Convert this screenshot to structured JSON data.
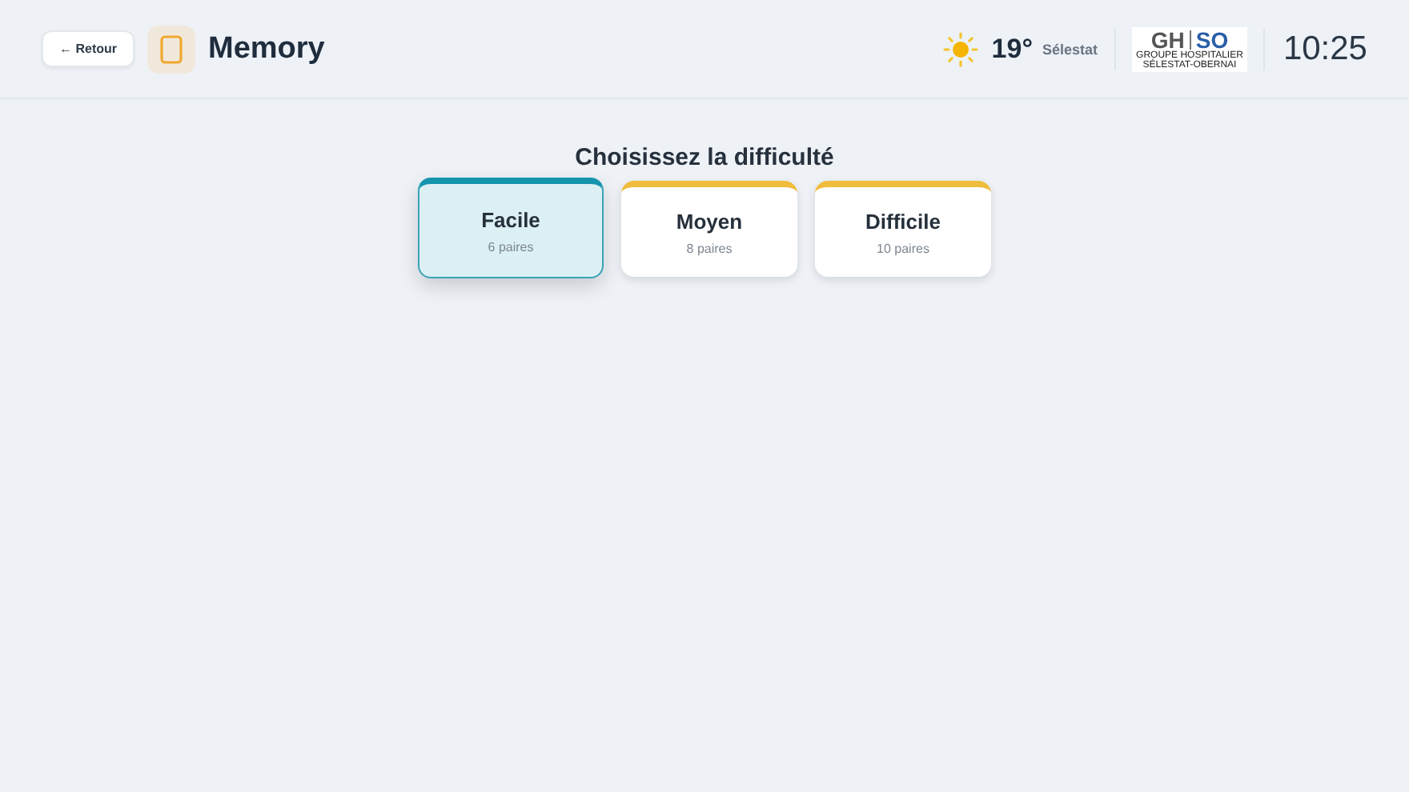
{
  "header": {
    "back_button": "← Retour",
    "title": "Memory",
    "weather": {
      "temperature": "19°",
      "city": "Sélestat"
    },
    "logo": {
      "left": "GH",
      "right": "SO",
      "line_1": "GROUPE HOSPITALIER",
      "line_2": "SÉLESTAT-OBERNAI"
    },
    "time": "10:25"
  },
  "heading": "Choisissez la difficulté",
  "levels": [
    {
      "label": "Facile",
      "pairs": "6 paires",
      "selected": true
    },
    {
      "label": "Moyen",
      "pairs": "8 paires",
      "selected": false
    },
    {
      "label": "Difficile",
      "pairs": "10 paires",
      "selected": false
    }
  ]
}
